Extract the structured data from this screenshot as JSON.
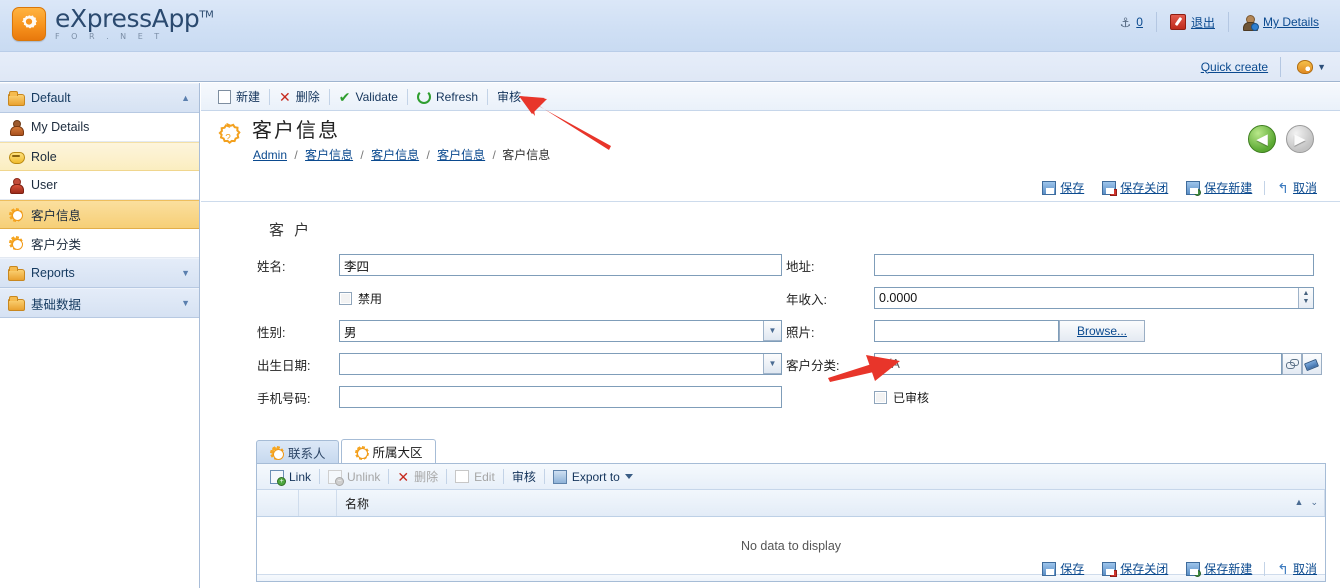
{
  "app": {
    "logo_main": "eXpressApp",
    "logo_tm": "TM",
    "logo_sub": "F O R . N E T"
  },
  "header": {
    "anchor_icon": "anchor-icon",
    "counter": "0",
    "logout_icon": "logout-icon",
    "logout_label": "退出",
    "my_details_icon": "user-info-icon",
    "my_details_label": "My Details"
  },
  "subheader": {
    "quick_create_label": "Quick create",
    "theme_icon": "palette-icon",
    "theme_caret": "▼"
  },
  "sidebar": {
    "items": [
      {
        "label": "Default",
        "icon": "folder-icon",
        "type": "group",
        "state": "expanded",
        "chevron": "▲"
      },
      {
        "label": "My Details",
        "icon": "person-icon",
        "type": "item",
        "state": "normal",
        "chevron": ""
      },
      {
        "label": "Role",
        "icon": "mask-icon",
        "type": "item",
        "state": "hover",
        "chevron": ""
      },
      {
        "label": "User",
        "icon": "user-icon",
        "type": "item",
        "state": "normal",
        "chevron": ""
      },
      {
        "label": "客户信息",
        "icon": "gear-icon",
        "type": "item",
        "state": "selected",
        "chevron": ""
      },
      {
        "label": "客户分类",
        "icon": "gear-icon",
        "type": "item",
        "state": "normal",
        "chevron": ""
      },
      {
        "label": "Reports",
        "icon": "folder-icon",
        "type": "group",
        "state": "collapsed",
        "chevron": "▼"
      },
      {
        "label": "基础数据",
        "icon": "folder-icon",
        "type": "group",
        "state": "collapsed",
        "chevron": "▼"
      }
    ]
  },
  "toolbar": {
    "buttons": [
      {
        "label": "新建",
        "icon": "new-document-icon"
      },
      {
        "label": "删除",
        "icon": "delete-x-icon"
      },
      {
        "label": "Validate",
        "icon": "check-icon"
      },
      {
        "label": "Refresh",
        "icon": "refresh-icon"
      },
      {
        "label": "审核",
        "icon": ""
      }
    ]
  },
  "page": {
    "title": "客户信息",
    "title_icon": "gear-icon",
    "breadcrumb": [
      {
        "label": "Admin",
        "link": true
      },
      {
        "label": "客户信息",
        "link": true
      },
      {
        "label": "客户信息",
        "link": true
      },
      {
        "label": "客户信息",
        "link": true
      },
      {
        "label": "客户信息",
        "link": false
      }
    ],
    "breadcrumb_separator": "/",
    "nav_back_icon": "arrow-left-icon",
    "nav_forward_icon": "arrow-right-icon",
    "nav_back_glyph": "◀",
    "nav_forward_glyph": "▶"
  },
  "actions": [
    {
      "label": "保存",
      "icon": "save-icon"
    },
    {
      "label": "保存关闭",
      "icon": "save-close-icon"
    },
    {
      "label": "保存新建",
      "icon": "save-new-icon"
    },
    {
      "label": "取消",
      "icon": "undo-icon"
    }
  ],
  "form": {
    "group_title": "客 户",
    "left": {
      "name_label": "姓名:",
      "name_value": "李四",
      "disabled_checkbox_label": "禁用",
      "disabled_checked": false,
      "gender_label": "性别:",
      "gender_value": "男",
      "birthdate_label": "出生日期:",
      "birthdate_value": "",
      "mobile_label": "手机号码:",
      "mobile_value": ""
    },
    "right": {
      "address_label": "地址:",
      "address_value": "",
      "income_label": "年收入:",
      "income_value": "0.0000",
      "photo_label": "照片:",
      "photo_value": "",
      "browse_label": "Browse...",
      "category_label": "客户分类:",
      "category_value": "N/A",
      "category_link_icon": "chain-icon",
      "category_clear_icon": "eraser-icon",
      "audited_checkbox_label": "已审核",
      "audited_checked": false
    }
  },
  "tabs": [
    {
      "label": "联系人",
      "icon": "gear-icon",
      "active": false
    },
    {
      "label": "所属大区",
      "icon": "gear-icon",
      "active": true
    }
  ],
  "grid": {
    "toolbar": [
      {
        "label": "Link",
        "icon": "link-add-icon",
        "disabled": false
      },
      {
        "label": "Unlink",
        "icon": "link-remove-icon",
        "disabled": true
      },
      {
        "label": "删除",
        "icon": "delete-x-icon",
        "disabled": true
      },
      {
        "label": "Edit",
        "icon": "edit-icon",
        "disabled": true
      },
      {
        "label": "审核",
        "icon": "",
        "disabled": false
      },
      {
        "label": "Export to",
        "icon": "export-icon",
        "disabled": false,
        "caret": "▼"
      }
    ],
    "columns": [
      "名称"
    ],
    "rows": [],
    "empty_text": "No data to display",
    "sort_icon": "sort-asc-icon",
    "filter_icon": "filter-icon",
    "sort_glyph": "▲",
    "filter_glyph": "⌄"
  },
  "annotations": [
    {
      "name": "arrow-to-audit-toolbar-button",
      "color": "#e8352a"
    },
    {
      "name": "arrow-to-audited-checkbox",
      "color": "#e8352a"
    }
  ],
  "colors": {
    "header_bg": "#cfdff4",
    "selected_nav": "#f6cf77",
    "hover_nav": "#fbeec0",
    "link": "#0b4a8f",
    "annotation_red": "#e8352a"
  }
}
